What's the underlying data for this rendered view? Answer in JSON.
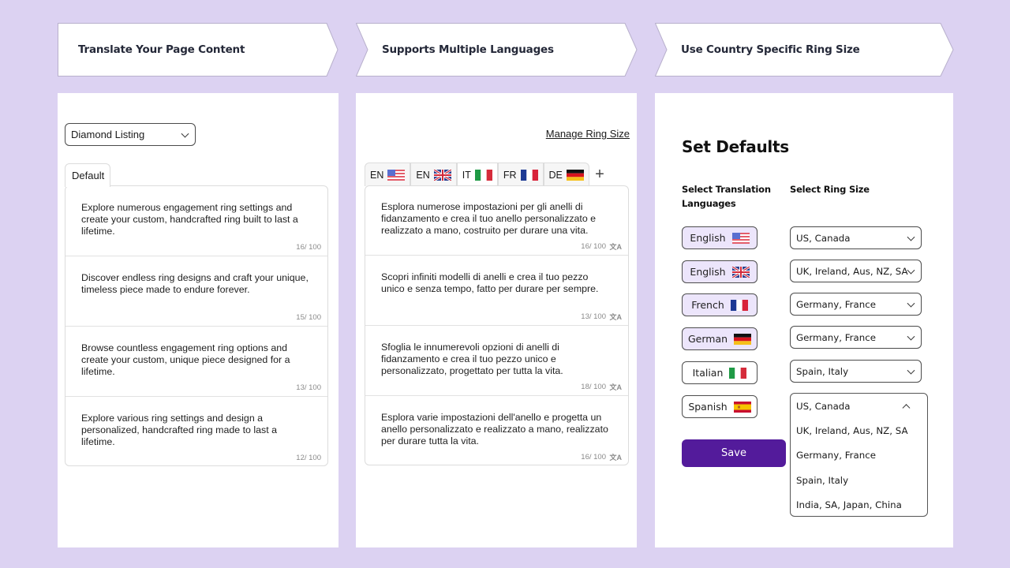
{
  "steps": [
    {
      "label": "Translate Your Page Content"
    },
    {
      "label": "Supports Multiple Languages"
    },
    {
      "label": "Use Country Specific Ring Size"
    }
  ],
  "panel1": {
    "listing_select": {
      "value": "Diamond Listing",
      "icon": "chevron-down-icon"
    },
    "tab_label": "Default",
    "entries": [
      {
        "text": "Explore numerous engagement ring settings and create your custom, handcrafted ring built to last a lifetime.",
        "count": "16/ 100"
      },
      {
        "text": "Discover endless ring designs and craft your unique, timeless piece made to endure forever.",
        "count": "15/ 100"
      },
      {
        "text": "Browse countless engagement ring options and create your custom, unique piece designed for a lifetime.",
        "count": "13/ 100"
      },
      {
        "text": "Explore various ring settings and design a personalized, handcrafted ring made to last a lifetime.",
        "count": "12/ 100"
      }
    ]
  },
  "panel2": {
    "manage_link": "Manage Ring Size",
    "tabs": [
      {
        "code": "EN",
        "flag": "us-flag-icon",
        "active": false
      },
      {
        "code": "EN",
        "flag": "uk-flag-icon",
        "active": false
      },
      {
        "code": "IT",
        "flag": "italy-flag-icon",
        "active": true
      },
      {
        "code": "FR",
        "flag": "france-flag-icon",
        "active": false
      },
      {
        "code": "DE",
        "flag": "germany-flag-icon",
        "active": false
      }
    ],
    "add_tab": "+",
    "translate_icon": "文A",
    "entries": [
      {
        "text": "Esplora numerose impostazioni per gli anelli di fidanzamento e crea il tuo anello personalizzato e realizzato a mano, costruito per durare una vita.",
        "count": "16/ 100"
      },
      {
        "text": "Scopri infiniti modelli di anelli e crea il tuo pezzo unico e senza tempo, fatto per durare per sempre.",
        "count": "13/ 100"
      },
      {
        "text": "Sfoglia le innumerevoli opzioni di anelli di fidanzamento e crea il tuo pezzo unico e personalizzato, progettato per tutta la vita.",
        "count": "18/ 100"
      },
      {
        "text": "Esplora varie impostazioni dell'anello e progetta un anello personalizzato e realizzato a mano, realizzato per durare tutta la vita.",
        "count": "16/ 100"
      }
    ]
  },
  "panel3": {
    "title": "Set Defaults",
    "col_languages": "Select Translation Languages",
    "col_ring_size": "Select Ring Size",
    "rows": [
      {
        "language": "English",
        "flag": "us-flag-icon",
        "selected": true,
        "ring_size": "US, Canada"
      },
      {
        "language": "English",
        "flag": "uk-flag-icon",
        "selected": true,
        "ring_size": "UK, Ireland, Aus, NZ, SA"
      },
      {
        "language": "French",
        "flag": "france-flag-icon",
        "selected": true,
        "ring_size": "Germany, France"
      },
      {
        "language": "German",
        "flag": "germany-flag-icon",
        "selected": true,
        "ring_size": "Germany, France"
      },
      {
        "language": "Italian",
        "flag": "italy-flag-icon",
        "selected": false,
        "ring_size": "Spain, Italy"
      },
      {
        "language": "Spanish",
        "flag": "spain-flag-icon",
        "selected": false,
        "ring_size": "US, Canada"
      }
    ],
    "open_dropdown": {
      "current": "US, Canada",
      "options": [
        "UK, Ireland, Aus, NZ, SA",
        "Germany, France",
        "Spain, Italy",
        "India, SA, Japan, China"
      ]
    },
    "save_label": "Save"
  },
  "colors": {
    "background": "#dcd2f2",
    "accent": "#531b9b",
    "selected_pill": "#ece5fb"
  }
}
